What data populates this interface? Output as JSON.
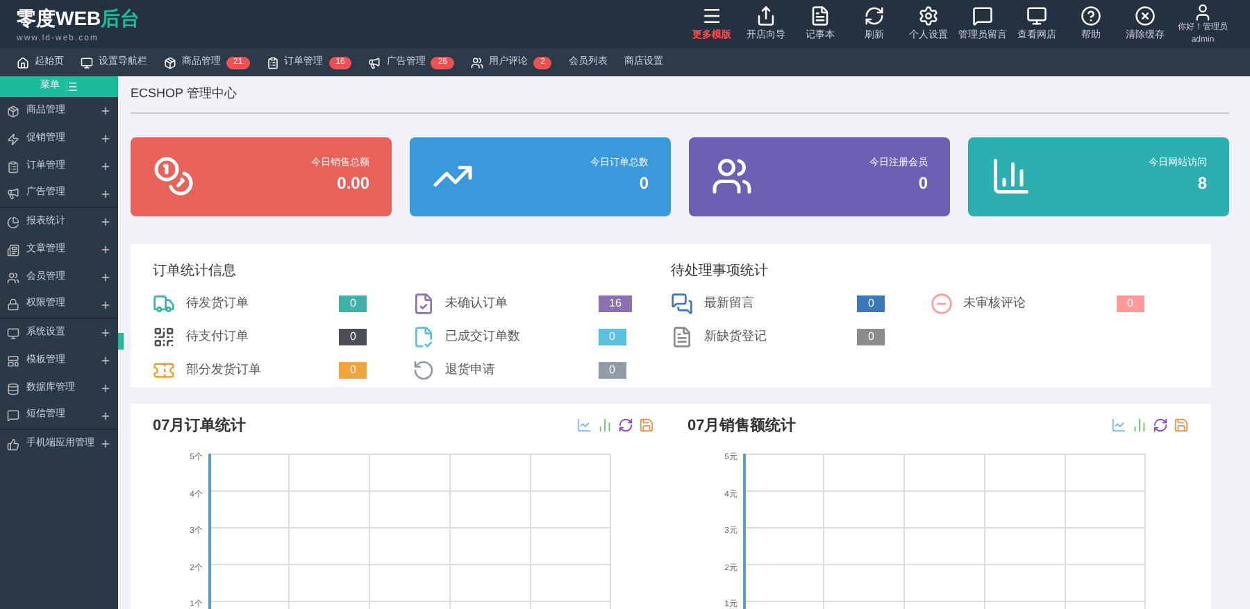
{
  "logo": {
    "main": "零度WEB",
    "accent": "后台",
    "site": "www.ld-web.com"
  },
  "toolbar": [
    {
      "kind": "menu",
      "label": "更多模版",
      "highlight": true
    },
    {
      "kind": "share",
      "label": "开店向导",
      "highlight": false
    },
    {
      "kind": "note",
      "label": "记事本",
      "highlight": false
    },
    {
      "kind": "refresh",
      "label": "刷新",
      "highlight": false
    },
    {
      "kind": "gear",
      "label": "个人设置",
      "highlight": false
    },
    {
      "kind": "message",
      "label": "管理员留言",
      "highlight": false
    },
    {
      "kind": "monitor",
      "label": "查看网店",
      "highlight": false
    },
    {
      "kind": "help",
      "label": "帮助",
      "highlight": false
    },
    {
      "kind": "clear",
      "label": "清除缓存",
      "highlight": false
    }
  ],
  "user": {
    "greeting": "你好！管理员",
    "name": "admin"
  },
  "nav": [
    {
      "kind": "home",
      "label": "起始页"
    },
    {
      "kind": "monitor",
      "label": "设置导航栏"
    },
    {
      "kind": "goods",
      "label": "商品管理",
      "badge": "21"
    },
    {
      "kind": "order",
      "label": "订单管理",
      "badge": "16"
    },
    {
      "kind": "ad",
      "label": "广告管理",
      "badge": "26"
    },
    {
      "kind": "users",
      "label": "用户评论",
      "badge": "2"
    },
    {
      "kind": "none",
      "label": "会员列表"
    },
    {
      "kind": "none",
      "label": "商店设置"
    }
  ],
  "sidebar": {
    "title": "菜单",
    "items": [
      {
        "kind": "goods",
        "label": "商品管理"
      },
      {
        "kind": "promo",
        "label": "促销管理"
      },
      {
        "kind": "order",
        "label": "订单管理"
      },
      {
        "kind": "ad",
        "label": "广告管理"
      },
      {
        "kind": "chart",
        "label": "报表统计"
      },
      {
        "kind": "article",
        "label": "文章管理"
      },
      {
        "kind": "users",
        "label": "会员管理"
      },
      {
        "kind": "lock",
        "label": "权限管理"
      },
      {
        "kind": "monitor",
        "label": "系统设置"
      },
      {
        "kind": "template",
        "label": "模板管理"
      },
      {
        "kind": "db",
        "label": "数据库管理"
      },
      {
        "kind": "message",
        "label": "短信管理"
      },
      {
        "kind": "thumb",
        "label": "手机端应用管理"
      }
    ]
  },
  "page_title": "ECSHOP 管理中心",
  "cards": [
    {
      "kind": "coins",
      "label": "今日销售总额",
      "value": "0.00",
      "color": "#e8625a"
    },
    {
      "kind": "trend",
      "label": "今日订单总数",
      "value": "0",
      "color": "#3a98dc"
    },
    {
      "kind": "users",
      "label": "今日注册会员",
      "value": "0",
      "color": "#6e5fb5"
    },
    {
      "kind": "bars",
      "label": "今日网站访问",
      "value": "8",
      "color": "#2bafb0"
    }
  ],
  "order_stats": {
    "title": "订单统计信息",
    "items": [
      {
        "kind": "truck",
        "label": "待发货订单",
        "count": "0",
        "color": "#3fb1a6"
      },
      {
        "kind": "doc",
        "label": "未确认订单",
        "count": "16",
        "color": "#8b71b2"
      },
      {
        "kind": "qr",
        "label": "待支付订单",
        "count": "0",
        "color": "#4b4f55"
      },
      {
        "kind": "done",
        "label": "已成交订单数",
        "count": "0",
        "color": "#5bc0de"
      },
      {
        "kind": "part",
        "label": "部分发货订单",
        "count": "0",
        "color": "#f0a43c"
      },
      {
        "kind": "refund",
        "label": "退货申请",
        "count": "0",
        "color": "#939ba8"
      }
    ]
  },
  "pending_stats": {
    "title": "待处理事项统计",
    "items": [
      {
        "kind": "chat",
        "label": "最新留言",
        "count": "0",
        "color": "#3a78b8"
      },
      {
        "kind": "comment",
        "label": "未审核评论",
        "count": "0",
        "color": "#ff9a99"
      },
      {
        "kind": "note",
        "label": "新缺货登记",
        "count": "0",
        "color": "#8c8c8c"
      }
    ]
  },
  "charts": [
    {
      "title": "07月订单统计",
      "y_labels": [
        "5个",
        "4个",
        "3个",
        "2个",
        "1个"
      ]
    },
    {
      "title": "07月销售额统计",
      "y_labels": [
        "5元",
        "4元",
        "3元",
        "2元",
        "1元"
      ]
    }
  ]
}
